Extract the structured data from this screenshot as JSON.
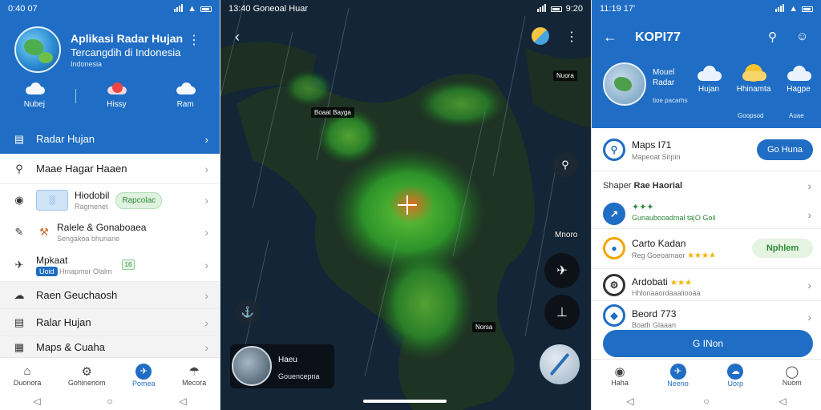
{
  "panel1": {
    "status": {
      "time": "0:40 07"
    },
    "app_title": "Aplikasi Radar Hujan",
    "app_subtitle": "Tercangdih di Indonesia",
    "app_small": "Indonesia",
    "weather": [
      {
        "label": "Nubej",
        "icon": "cloud-icon"
      },
      {
        "label": "Hissy",
        "icon": "storm-cloud-icon"
      },
      {
        "label": "Ram",
        "icon": "cloud-icon"
      }
    ],
    "menu_active": "Radar Hujan",
    "menu": [
      {
        "label": "Maae Hagar Haaen",
        "icon": "search-icon"
      },
      {
        "title": "Hiodobil",
        "sub": "Ragmenet",
        "badge": "Rapcolac"
      },
      {
        "title": "Ralele & Gonaboaea",
        "sub": "Sengakoa bhunane"
      },
      {
        "title": "Mpkaat",
        "sub": "Hmapmor Olalm",
        "tag": "Uoid",
        "tag2": "16"
      }
    ],
    "section2": [
      {
        "label": "Raen Geuchaosh"
      },
      {
        "label": "Ralar Hujan"
      },
      {
        "label": "Maps & Cuaha"
      }
    ],
    "nav": [
      "Duonora",
      "Gohinenom",
      "Pomea",
      "Mecora"
    ]
  },
  "panel2": {
    "status": {
      "time": "13:40 Goneoal Huar",
      "right": "9:20"
    },
    "labels": [
      "Nuora",
      "Boaat Bayga",
      "Mnoro",
      "Norsa"
    ],
    "card_line1": "Haeu",
    "card_line2": "Gouencepna"
  },
  "panel3": {
    "status": {
      "time": "11:19 17'"
    },
    "title": "KOPI77",
    "loc_line1": "Mouel",
    "loc_line2": "Radar",
    "loc_line3": "tioe pacarhs",
    "weather": [
      {
        "label": "Hujan",
        "sub": ""
      },
      {
        "label": "Hhinamta",
        "sub": "Goopsod"
      },
      {
        "label": "Hagpe",
        "sub": "Auae"
      }
    ],
    "card1": {
      "title": "Maps I71",
      "sub": "Mapeoat Sirpin",
      "button": "Go Huna"
    },
    "section_title": "Shaper",
    "section_title_bold": "Rae Haorial",
    "rows": [
      {
        "title": "",
        "sub": "Gunaubooadmal ta|O Goil",
        "stars": "✦✦✦"
      },
      {
        "title": "Carto Kadan",
        "sub": "Reg Goeoamaor",
        "button": "Nphlem",
        "stars": "★★★★"
      },
      {
        "title": "Ardobati",
        "sub": "Hhlonaaordaaaliooaa",
        "stars": "★★★"
      },
      {
        "title": "Beord 773",
        "sub": "Boath Glaaan"
      }
    ],
    "main_button": "G INon",
    "nav": [
      "Haha",
      "Neeno",
      "Uorp",
      "Nuom"
    ]
  }
}
